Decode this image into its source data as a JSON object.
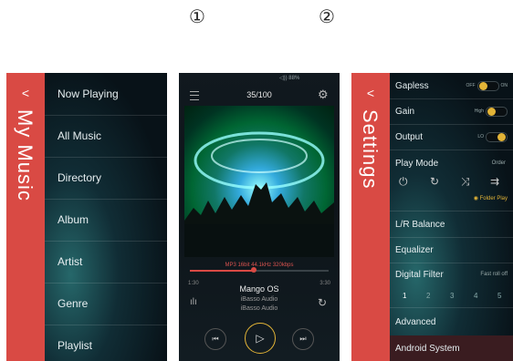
{
  "callouts": [
    "①",
    "②"
  ],
  "my_music": {
    "back": "<",
    "title": "My Music",
    "items": [
      "Now Playing",
      "All Music",
      "Directory",
      "Album",
      "Artist",
      "Genre",
      "Playlist"
    ]
  },
  "player": {
    "status": "◁)) 88%",
    "counter": "35/100",
    "format": "MP3 16bit 44.1kHz 320kbps",
    "progress": 0.46,
    "time_elapsed": "1:30",
    "time_total": "3:30",
    "song": "Mango OS",
    "artist": "iBasso Audio",
    "album": "iBasso Audio"
  },
  "settings": {
    "back": "<",
    "title": "Settings",
    "gapless": {
      "label": "Gapless",
      "off": "OFF",
      "on": "ON"
    },
    "gain": {
      "label": "Gain",
      "value": "High"
    },
    "output": {
      "label": "Output",
      "value": "LO"
    },
    "play_mode": {
      "label": "Play Mode",
      "value": "Order",
      "folder_play": "Folder Play"
    },
    "lr_balance": "L/R Balance",
    "equalizer": "Equalizer",
    "digital_filter": {
      "label": "Digital Filter",
      "value": "Fast roll off",
      "options": [
        "1",
        "2",
        "3",
        "4",
        "5"
      ]
    },
    "advanced": "Advanced",
    "android_system": "Android System"
  },
  "colors": {
    "accent": "#d94a44",
    "knob": "#e3b437"
  }
}
